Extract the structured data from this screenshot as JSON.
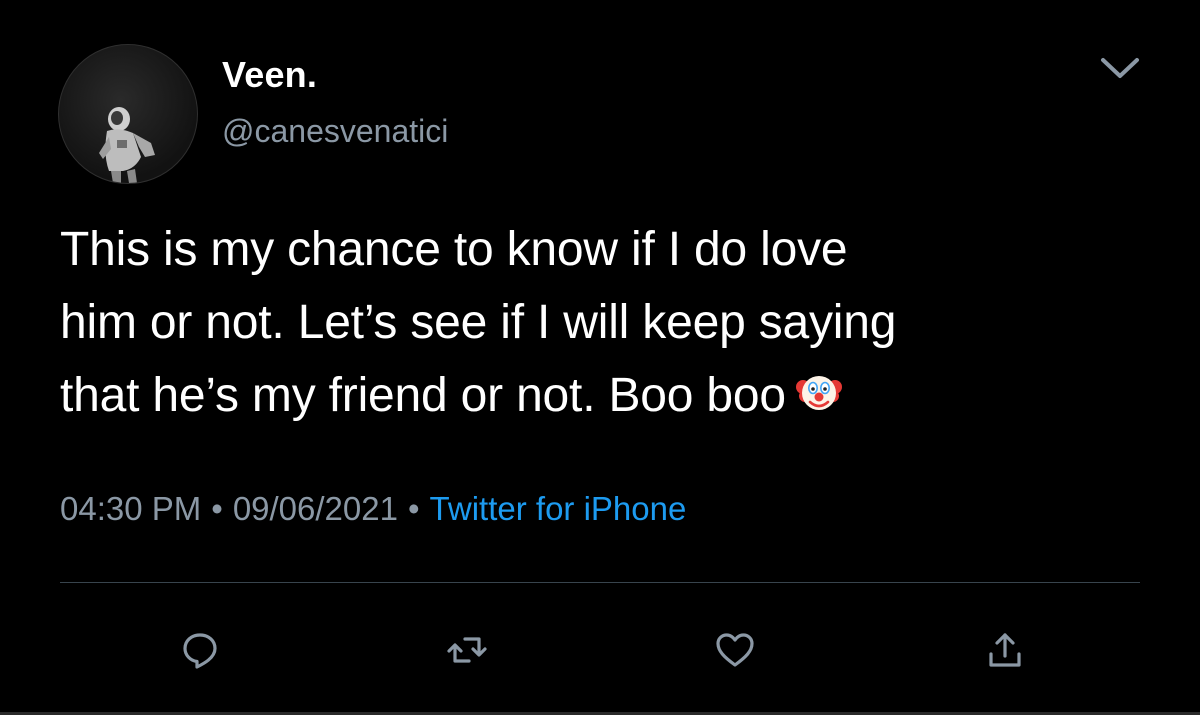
{
  "user": {
    "display_name": "Veen.",
    "handle": "@canesvenatici"
  },
  "tweet": {
    "text_lines": [
      "This is my chance to know if I do love",
      "him or not. Let’s see if I will keep saying",
      "that he’s my friend or not. Boo boo"
    ],
    "emoji": "clown-face"
  },
  "meta": {
    "time": "04:30 PM",
    "separator": "•",
    "date": "09/06/2021",
    "source": "Twitter for iPhone"
  },
  "actions": {
    "reply": "reply-icon",
    "retweet": "retweet-icon",
    "like": "heart-icon",
    "share": "share-icon"
  },
  "colors": {
    "background": "#000000",
    "text": "#ffffff",
    "secondary_text": "#8b98a5",
    "link": "#1d9bf0",
    "divider": "#38444d"
  }
}
